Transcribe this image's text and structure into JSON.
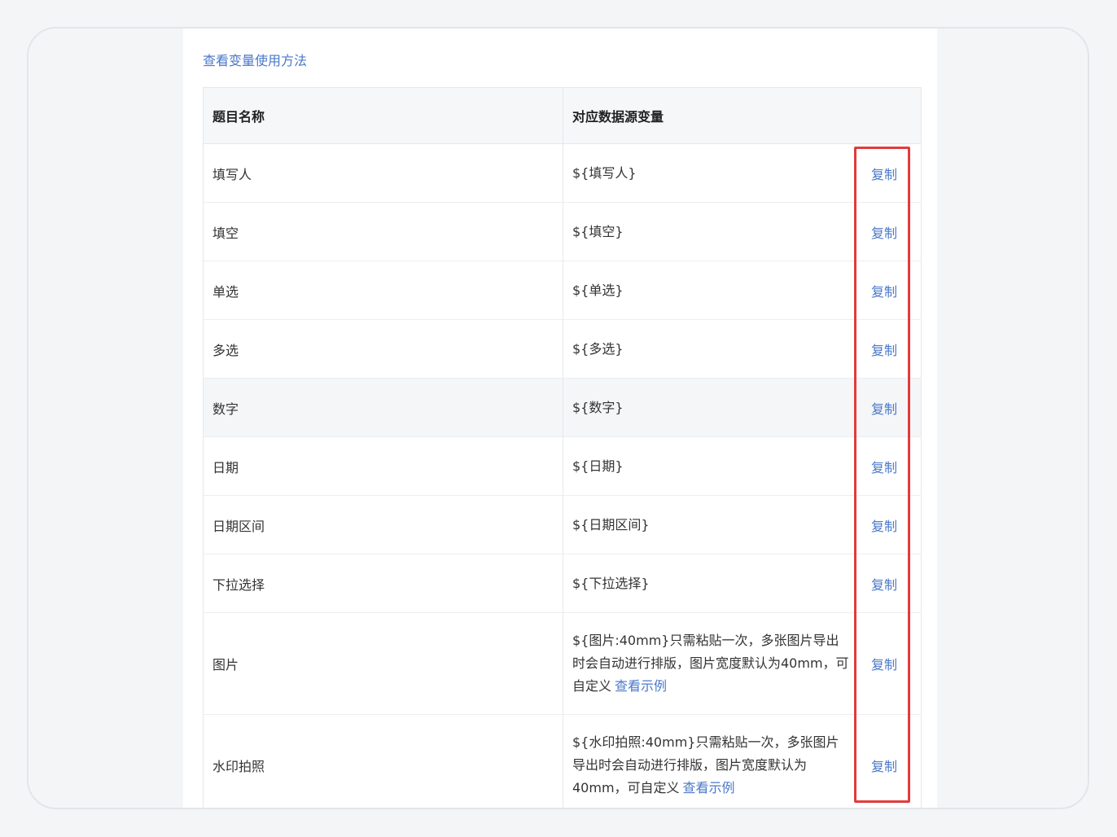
{
  "help_link": "查看变量使用方法",
  "table": {
    "headers": [
      "题目名称",
      "对应数据源变量"
    ],
    "copy_label": "复制",
    "example_label": "查看示例",
    "rows": [
      {
        "name": "填写人",
        "var": "${填写人}"
      },
      {
        "name": "填空",
        "var": "${填空}"
      },
      {
        "name": "单选",
        "var": "${单选}"
      },
      {
        "name": "多选",
        "var": "${多选}"
      },
      {
        "name": "数字",
        "var": "${数字}"
      },
      {
        "name": "日期",
        "var": "${日期}"
      },
      {
        "name": "日期区间",
        "var": "${日期区间}"
      },
      {
        "name": "下拉选择",
        "var": "${下拉选择}"
      },
      {
        "name": "图片",
        "var": "${图片:40mm}只需粘贴一次，多张图片导出时会自动进行排版，图片宽度默认为40mm，可自定义"
      },
      {
        "name": "水印拍照",
        "var": "${水印拍照:40mm}只需粘贴一次，多张图片导出时会自动进行排版，图片宽度默认为40mm，可自定义"
      }
    ]
  },
  "colors": {
    "link": "#4a78c9",
    "highlight_border": "#e23b3b",
    "header_bg": "#f6f7f9"
  }
}
